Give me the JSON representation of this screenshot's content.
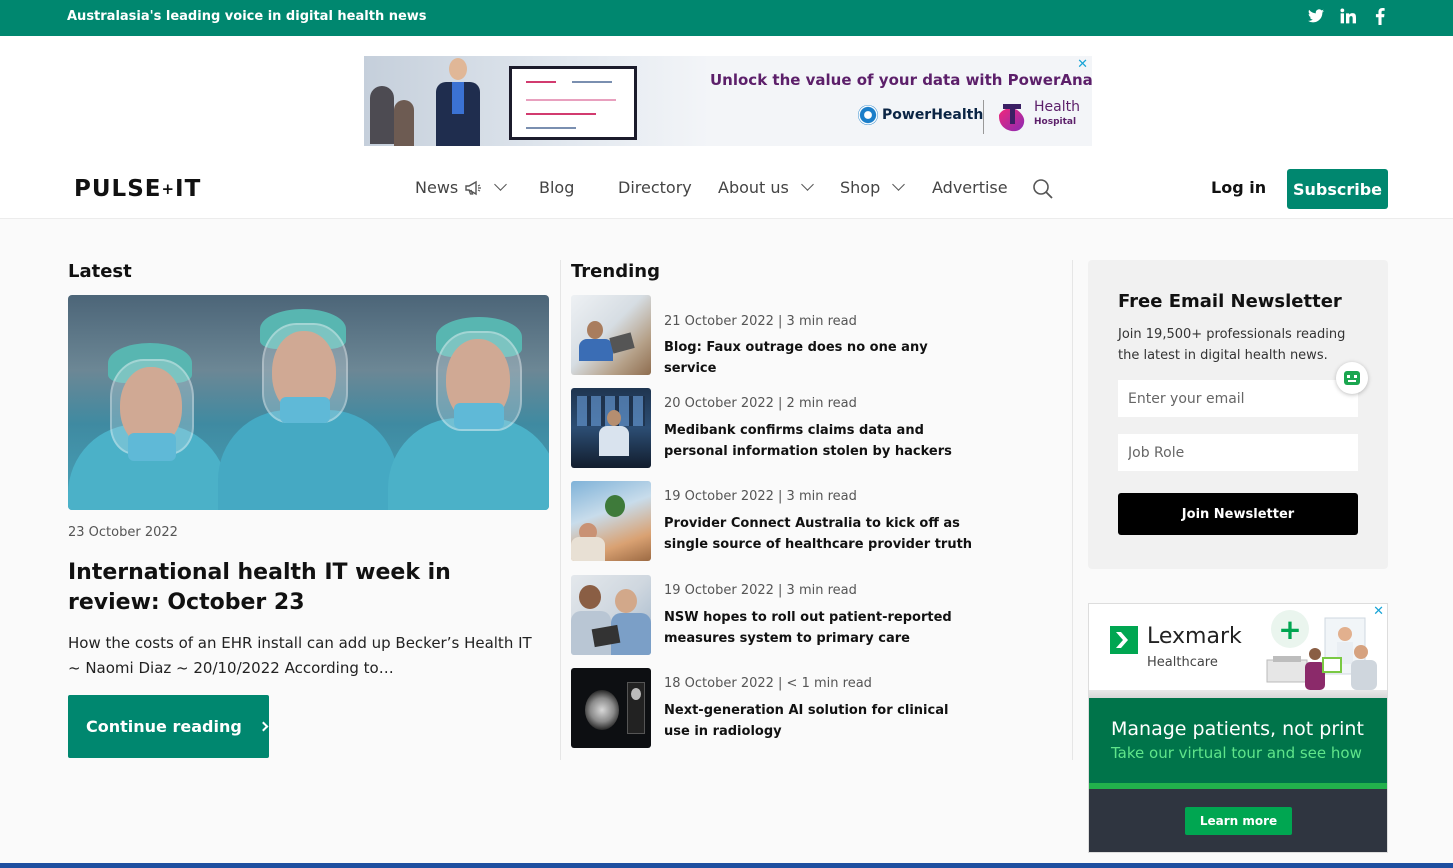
{
  "topbar": {
    "tagline": "Australasia's leading voice in digital health news",
    "social": [
      "twitter-icon",
      "linkedin-icon",
      "facebook-icon"
    ],
    "color": "#00876f"
  },
  "ad_top": {
    "headline": "Unlock the value of your data with PowerAnalytics",
    "brand1": "PowerHealth",
    "brand2": "Health",
    "brand2_sub": "Hospital",
    "close": "✕"
  },
  "header": {
    "logo": "PULSE",
    "logo_plus": "+",
    "logo_suffix": "IT",
    "nav": [
      {
        "label": "News"
      },
      {
        "label": "Blog"
      },
      {
        "label": "Directory"
      },
      {
        "label": "About us"
      },
      {
        "label": "Shop"
      },
      {
        "label": "Advertise"
      }
    ],
    "login": "Log in",
    "subscribe": "Subscribe"
  },
  "latest": {
    "heading": "Latest",
    "date": "23 October 2022",
    "title": "International health IT week in review: October 23",
    "excerpt": "How the costs of an EHR install can add up Becker’s Health IT ~ Naomi Diaz ~ 20/10/2022 According to…",
    "cta": "Continue reading"
  },
  "trending": {
    "heading": "Trending",
    "items": [
      {
        "meta": "21 October 2022 | 3 min read",
        "title": "Blog: Faux outrage does no one any service"
      },
      {
        "meta": "20 October 2022 | 2 min read",
        "title": "Medibank confirms claims data and personal information stolen by hackers"
      },
      {
        "meta": "19 October 2022 | 3 min read",
        "title": "Provider Connect Australia to kick off as single source of healthcare provider truth"
      },
      {
        "meta": "19 October 2022 | 3 min read",
        "title": "NSW hopes to roll out patient-reported measures system to primary care"
      },
      {
        "meta": "18 October 2022 | < 1 min read",
        "title": "Next-generation AI solution for clinical use in radiology"
      }
    ]
  },
  "newsletter": {
    "title": "Free Email Newsletter",
    "desc": "Join 19,500+ professionals reading the latest in digital health news.",
    "email_placeholder": "Enter your email",
    "role_placeholder": "Job Role",
    "button": "Join Newsletter"
  },
  "ad_side": {
    "brand": "Lexmark",
    "brand_sub": "Healthcare",
    "line1": "Manage patients, not print",
    "line2": "Take our virtual tour and see how",
    "cta": "Learn more",
    "close": "✕"
  }
}
